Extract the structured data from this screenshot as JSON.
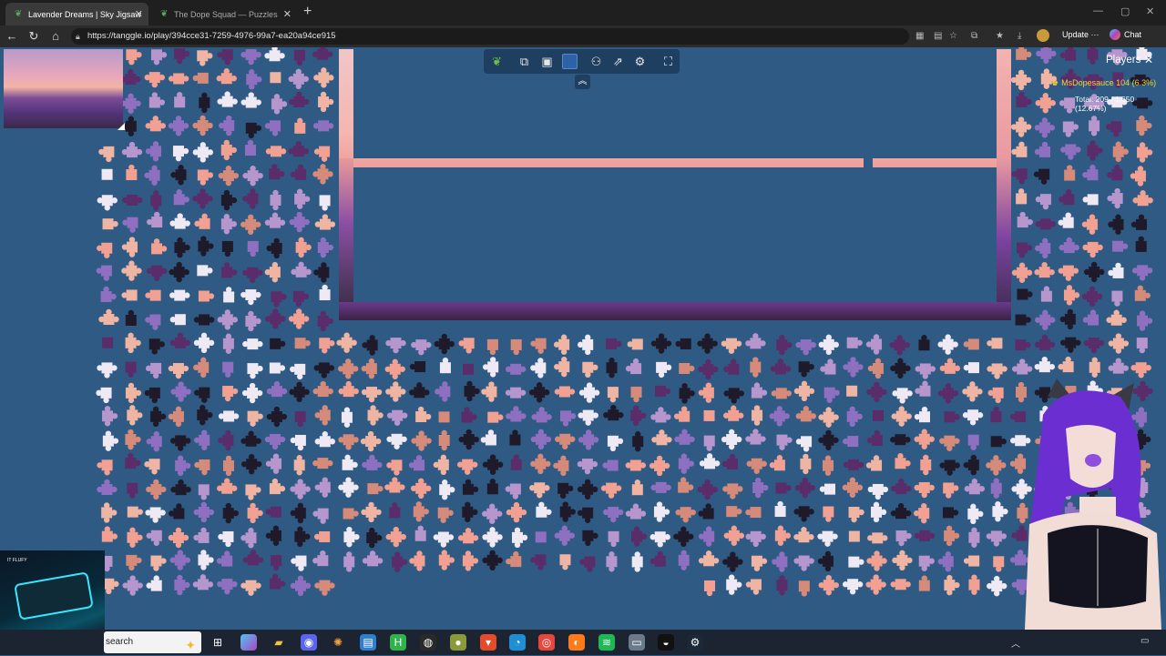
{
  "browser": {
    "tabs": [
      {
        "title": "Lavender Dreams | Sky Jigsaw",
        "active": true
      },
      {
        "title": "The Dope Squad — Puzzles",
        "active": false
      }
    ],
    "url": "https://tanggle.io/play/394cce31-7259-4976-99a7-ea20a94ce915",
    "update_label": "Update",
    "chat_label": "Chat",
    "icons": [
      "back-icon",
      "refresh-icon",
      "home-icon",
      "lock-icon",
      "close-icon",
      "plus-icon",
      "minimize-icon",
      "maximize-icon"
    ]
  },
  "toolbar": {
    "tools": [
      "leaf-icon",
      "puzzle-piece-icon",
      "image-preview-icon",
      "background-color",
      "players-icon",
      "share-icon",
      "settings-icon",
      "fullscreen-icon"
    ],
    "collapse_icon": "chevron-up-icon",
    "background_color": "#2f5a84"
  },
  "players": {
    "title": "Players",
    "list": [
      {
        "name": "MsDopesauce",
        "score": "104 (6.3%)"
      }
    ],
    "total": "Total: 209 / 1,650 (12.67%)"
  },
  "webcam": {
    "label": "IT FLUFY"
  },
  "taskbar": {
    "search_placeholder": "search",
    "apps": [
      "task-view",
      "copilot",
      "file-explorer",
      "discord",
      "spark",
      "sysinfo",
      "hextris",
      "onyx",
      "game",
      "brave",
      "edge",
      "chrome",
      "firefox",
      "spotify",
      "screenshot",
      "github",
      "steam"
    ]
  },
  "colors": {
    "board": "#2f5a84",
    "piece_palette": [
      "#f2a091",
      "#efe9f3",
      "#8f70c0",
      "#b696cc",
      "#1e1a2a",
      "#5a2c6a",
      "#d68a7a",
      "#f0b4a3"
    ]
  }
}
